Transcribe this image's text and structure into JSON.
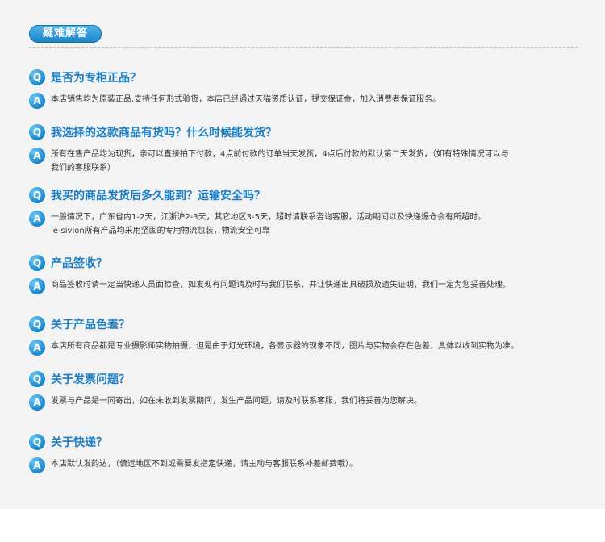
{
  "section_title": "疑难解答",
  "faqs": [
    {
      "q": "是否为专柜正品？",
      "a": [
        "本店销售均为原装正品,支持任何形式验货，本店已经通过天猫资质认证，提交保证金，加入消费者保证服务。"
      ]
    },
    {
      "q": "我选择的这款商品有货吗？什么时候能发货？",
      "a": [
        "所有在售产品均为现货，亲可以直接拍下付款，4点前付款的订单当天发货，4点后付款的默认第二天发货，（如有特殊情况可以与",
        "我们的客服联系）"
      ]
    },
    {
      "q": "我买的商品发货后多久能到？运输安全吗？",
      "a": [
        "一般情况下，广东省内1-2天，江浙沪2-3天，其它地区3-5天，超时请联系咨询客服，活动期间以及快递爆仓会有所超时。",
        "le-sivion所有产品均采用坚固的专用物流包装，物流安全可靠"
      ]
    },
    {
      "q": "产品签收？",
      "a": [
        "商品签收时请一定当快递人员面检查，如发现有问题请及时与我们联系，并让快递出具破损及遗失证明，我们一定为您妥善处理。"
      ]
    },
    {
      "q": "关于产品色差？",
      "a": [
        "本店所有商品都是专业摄影师实物拍摄，但是由于灯光环境，各显示器的现象不同，图片与实物会存在色差，具体以收到实物为准。"
      ]
    },
    {
      "q": "关于发票问题？",
      "a": [
        "发票与产品是一同寄出，如在未收到发票期间，发生产品问题，请及时联系客服，我们将妥善为您解决。"
      ]
    },
    {
      "q": "关于快递？",
      "a": [
        "本店默认发韵达，（偏远地区不到或需要发指定快递，请主动与客服联系补差邮费哦）。"
      ]
    }
  ],
  "icons": {
    "question_letter": "Q",
    "answer_letter": "A"
  },
  "colors": {
    "accent": "#1a7ec4",
    "panel_bg": "#f3f3f3",
    "answer_text": "#333333"
  }
}
